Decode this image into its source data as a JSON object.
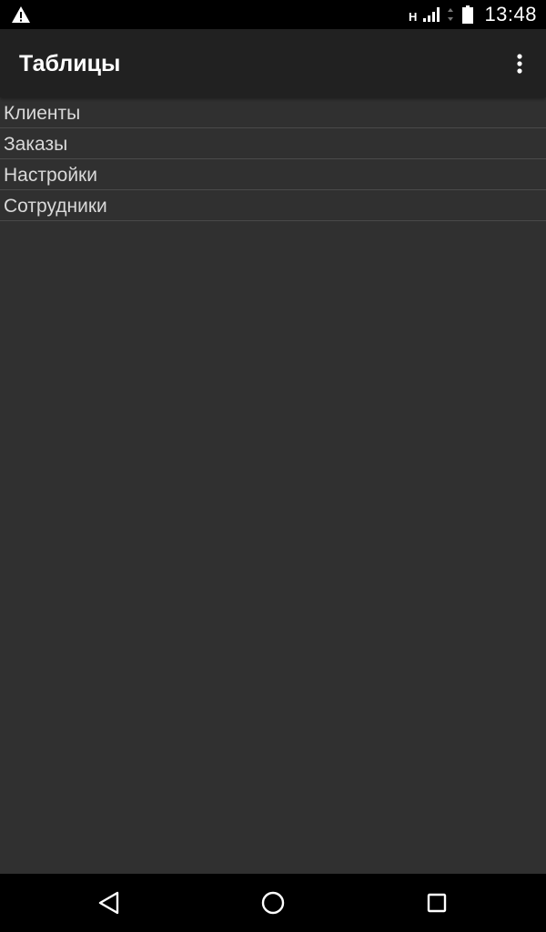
{
  "status_bar": {
    "network_type": "H",
    "time": "13:48",
    "icons": [
      "alert-icon",
      "signal-icon",
      "data-icon",
      "battery-icon"
    ]
  },
  "app_bar": {
    "title": "Таблицы",
    "overflow_icon": "more-vert-icon"
  },
  "tables": [
    {
      "label": "Клиенты"
    },
    {
      "label": "Заказы"
    },
    {
      "label": "Настройки"
    },
    {
      "label": "Сотрудники"
    }
  ],
  "nav_bar": {
    "icons": [
      "back-icon",
      "home-icon",
      "recents-icon"
    ]
  },
  "colors": {
    "background": "#303030",
    "app_bar": "#212121",
    "status_bar": "#000000",
    "list_text": "#d9d9d9",
    "divider": "#4a4a4a"
  }
}
